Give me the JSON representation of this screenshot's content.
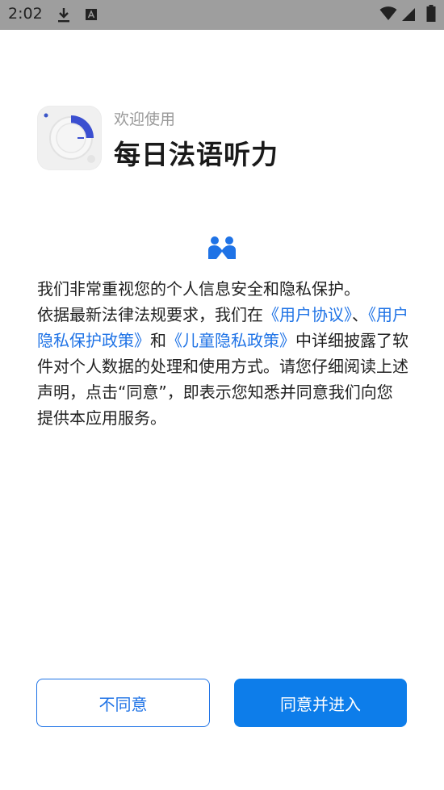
{
  "status_bar": {
    "time": "2:02",
    "icons": [
      "download-icon",
      "font-a-icon",
      "wifi-icon",
      "signal-icon",
      "battery-icon"
    ]
  },
  "header": {
    "welcome": "欢迎使用",
    "app_name": "每日法语听力"
  },
  "policy": {
    "line1": "我们非常重视您的个人信息安全和隐私保护。",
    "line2_prefix": "依据最新法律法规要求，我们在",
    "link_user_agreement": "《用户协议》",
    "line2_suffix": "、",
    "link_privacy_policy": "《用户隐私保护政策》",
    "and_text": "和",
    "link_child_policy": "《儿童隐私政策》",
    "middle_text": "中详细披露了软件对个人数据的处理和使用方式。请您仔细阅读上述声明，点击“同意”，即表示您知悉并同意我们向您提供本应用服务。"
  },
  "buttons": {
    "decline": "不同意",
    "agree": "同意并进入"
  },
  "colors": {
    "accent": "#1f73e6",
    "primary_button": "#0d7dea",
    "status_bar": "#9e9e9e"
  }
}
